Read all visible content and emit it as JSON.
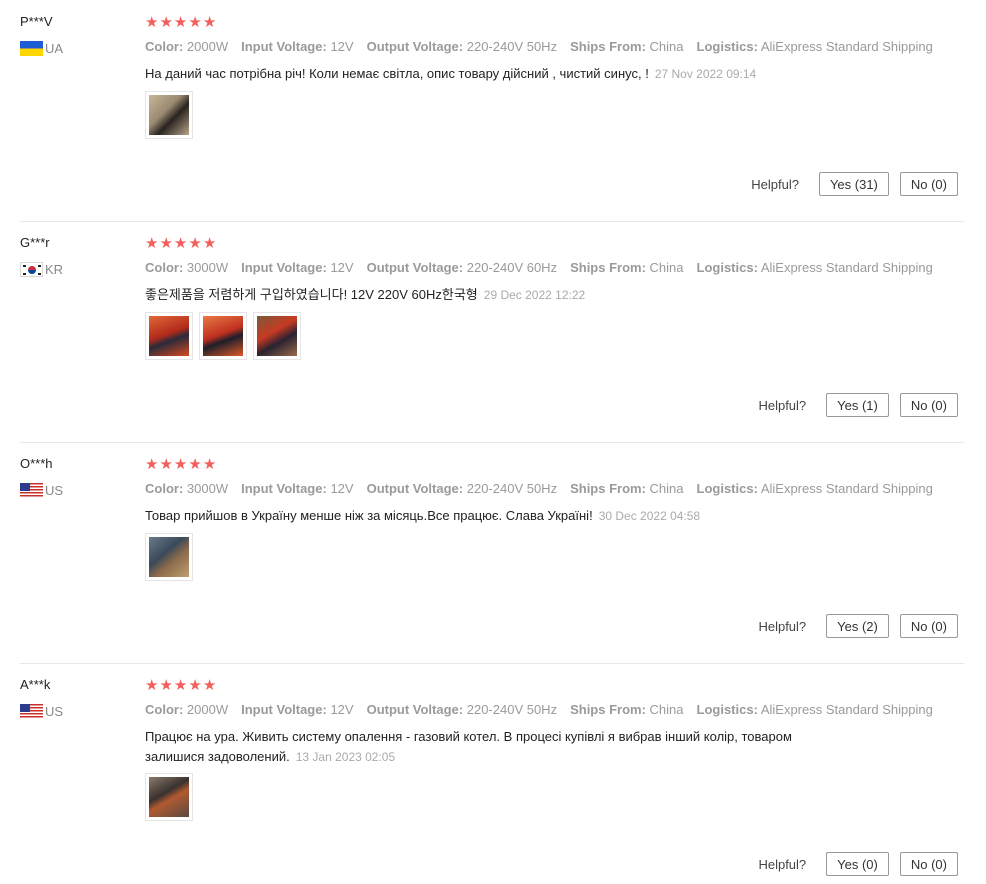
{
  "labels": {
    "color": "Color:",
    "input_voltage": "Input Voltage:",
    "output_voltage": "Output Voltage:",
    "ships_from": "Ships From:",
    "logistics": "Logistics:",
    "helpful": "Helpful?"
  },
  "reviews": [
    {
      "buyer": "P***V",
      "country": "UA",
      "flag_icon": "ukraine-flag-icon",
      "rating": 5,
      "stars": [
        "★",
        "★",
        "★",
        "★",
        "★"
      ],
      "color": "2000W",
      "input_voltage": "12V",
      "output_voltage": "220-240V 50Hz",
      "ships_from": "China",
      "logistics": "AliExpress Standard Shipping",
      "text": "На даний час потрібна річ! Коли немає світла, опис товару дійсний , чистий синус, !",
      "date": "27 Nov 2022 09:14",
      "photos": 1,
      "yes": "Yes (31)",
      "no": "No (0)"
    },
    {
      "buyer": "G***r",
      "country": "KR",
      "flag_icon": "south-korea-flag-icon",
      "rating": 5,
      "stars": [
        "★",
        "★",
        "★",
        "★",
        "★"
      ],
      "color": "3000W",
      "input_voltage": "12V",
      "output_voltage": "220-240V 60Hz",
      "ships_from": "China",
      "logistics": "AliExpress Standard Shipping",
      "text": "좋은제품을 저렴하게 구입하였습니다! 12V 220V 60Hz한국형",
      "date": "29 Dec 2022 12:22",
      "photos": 3,
      "yes": "Yes (1)",
      "no": "No (0)"
    },
    {
      "buyer": "O***h",
      "country": "US",
      "flag_icon": "usa-flag-icon",
      "rating": 5,
      "stars": [
        "★",
        "★",
        "★",
        "★",
        "★"
      ],
      "color": "3000W",
      "input_voltage": "12V",
      "output_voltage": "220-240V 50Hz",
      "ships_from": "China",
      "logistics": "AliExpress Standard Shipping",
      "text": "Товар прийшов в Україну менше ніж за місяць.Все працює. Слава Україні!",
      "date": "30 Dec 2022 04:58",
      "photos": 1,
      "yes": "Yes (2)",
      "no": "No (0)"
    },
    {
      "buyer": "A***k",
      "country": "US",
      "flag_icon": "usa-flag-icon",
      "rating": 5,
      "stars": [
        "★",
        "★",
        "★",
        "★",
        "★"
      ],
      "color": "2000W",
      "input_voltage": "12V",
      "output_voltage": "220-240V 50Hz",
      "ships_from": "China",
      "logistics": "AliExpress Standard Shipping",
      "text": "Працює на ура. Живить систему опалення - газовий котел. В процесі купівлі я вибрав інший колір, товаром залишися задоволений.",
      "date": "13 Jan 2023 02:05",
      "photos": 1,
      "yes": "Yes (0)",
      "no": "No (0)"
    }
  ]
}
